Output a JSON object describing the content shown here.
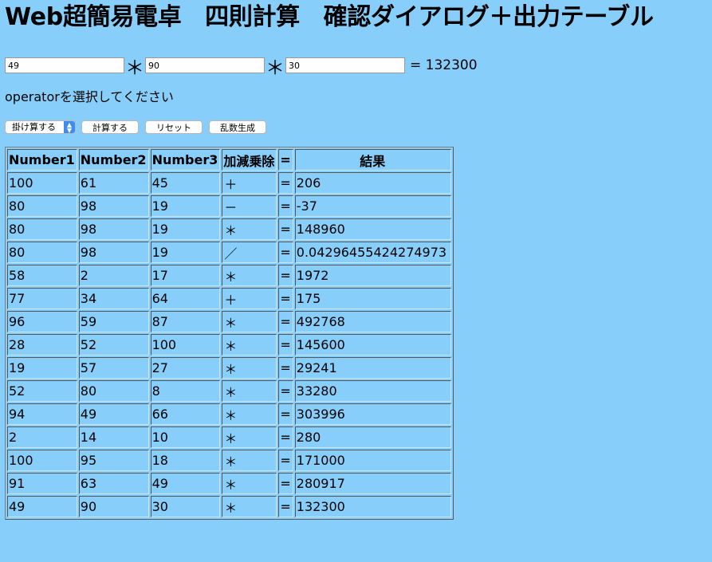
{
  "title": "Web超簡易電卓　四則計算　確認ダイアログ＋出力テーブル",
  "calc": {
    "number1": "49",
    "operator1": "＊",
    "number2": "90",
    "operator2": "＊",
    "number3": "30",
    "result": "= 132300"
  },
  "message": "operatorを選択してください",
  "controls": {
    "operator_select": "掛け算する",
    "calc_button": "計算する",
    "reset_button": "リセット",
    "random_button": "乱数生成"
  },
  "table": {
    "headers": [
      "Number1",
      "Number2",
      "Number3",
      "加減乗除",
      "=",
      "結果"
    ],
    "rows": [
      [
        "100",
        "61",
        "45",
        "＋",
        "=",
        "206"
      ],
      [
        "80",
        "98",
        "19",
        "－",
        "=",
        "-37"
      ],
      [
        "80",
        "98",
        "19",
        "＊",
        "=",
        "148960"
      ],
      [
        "80",
        "98",
        "19",
        "／",
        "=",
        "0.04296455424274973"
      ],
      [
        "58",
        "2",
        "17",
        "＊",
        "=",
        "1972"
      ],
      [
        "77",
        "34",
        "64",
        "＋",
        "=",
        "175"
      ],
      [
        "96",
        "59",
        "87",
        "＊",
        "=",
        "492768"
      ],
      [
        "28",
        "52",
        "100",
        "＊",
        "=",
        "145600"
      ],
      [
        "19",
        "57",
        "27",
        "＊",
        "=",
        "29241"
      ],
      [
        "52",
        "80",
        "8",
        "＊",
        "=",
        "33280"
      ],
      [
        "94",
        "49",
        "66",
        "＊",
        "=",
        "303996"
      ],
      [
        "2",
        "14",
        "10",
        "＊",
        "=",
        "280"
      ],
      [
        "100",
        "95",
        "18",
        "＊",
        "=",
        "171000"
      ],
      [
        "91",
        "63",
        "49",
        "＊",
        "=",
        "280917"
      ],
      [
        "49",
        "90",
        "30",
        "＊",
        "=",
        "132300"
      ]
    ]
  },
  "colors": {
    "background": "#87cefa",
    "select_caret": "#3d8cf0"
  },
  "icons": {
    "select_caret": "chevron-updown-icon"
  }
}
